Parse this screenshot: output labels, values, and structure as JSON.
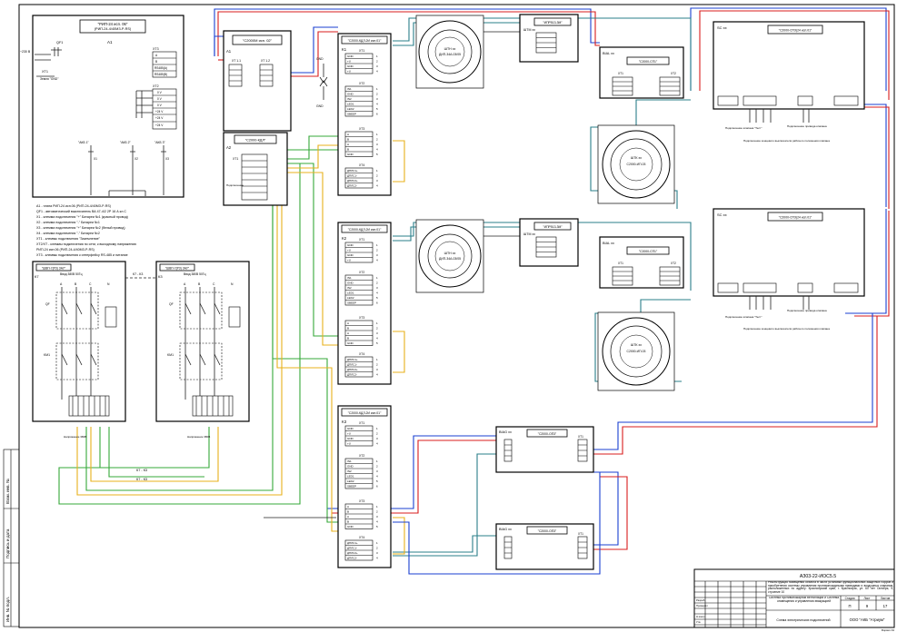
{
  "sheet": {
    "doc_code": "АЗ03-22-ИОС5.5",
    "project_title": "Реконструкция помещения объекта в части установки функциональных защитных гофров и приобретения системы управления противопожарными приводами и воздушных клапанов, расположенных по адресу: Красноярский край, г. Красноярск, ул. 60 лет Октября, 9, строение 10",
    "sheet_title": "Система противопожарной вентиляции и Система оповещения и управления эвакуацией",
    "scheme_title": "Схема электрических подключений",
    "company": "ООО \"АКБ \"Атриум\"",
    "stage_label": "Стадия",
    "stage": "П",
    "sheet_label": "Лист",
    "sheet_no": "9",
    "sheets_label": "Листов",
    "sheets_total": "17",
    "format": "Формат А3",
    "signature_rows": [
      "Разраб.",
      "Проверил",
      "Н.контр.",
      "Утв."
    ],
    "side_labels": [
      "Взам. инв. №",
      "Подпись и дата",
      "Инв. № подл."
    ]
  },
  "power_unit": {
    "id": "A1",
    "title_line1": "\"РИП-24 исп. 06\"",
    "title_line2": "(РИП-24-4/40МЗ-Р-RS)",
    "qf_label": "QF1",
    "mains_label": "~230 В",
    "ground_label": "Земля \"GND\"",
    "xt1_label": "ХТ1",
    "xt2_label": "ХТ2",
    "xt3_label": "ХТ3",
    "terminals_xt1": [
      "А",
      "В",
      "RS485(А)",
      "RS485(В)"
    ],
    "terminals_xt2": [
      "0 V",
      "0 V",
      "0 V",
      "+24 V",
      "+24 V",
      "+24 V"
    ],
    "batt_labels": [
      "\"АКБ 1\"",
      "\"АКБ 2\"",
      "\"АКБ 3\""
    ],
    "batt_ids": [
      "X1",
      "X2",
      "X3"
    ]
  },
  "legend": [
    "А1 - плата РИП-24 исп.06 (РИП-24-4/40МЗ-Р-RS)",
    "QF1 - автоматический выключатель ВА 47-4/2 2Р 16 А кл.С",
    "Х1 - клемма подключения \"+\" Батареи №1 (красный провод)",
    "Х2 - клемма подключения \"-\" Батареи №1",
    "Х3 - клемма подключения \"+\" Батареи №2 (белый провод)",
    "Х4 - клемма подключения \"-\" Батареи №2",
    "ХТ1 - клеммы подключения \"Заземление\"",
    "ХТ2/ХТ - клеммы подключения по сети, к выходному напряжению",
    "РИП-24 исп.06 (РИП-24-4/40МЗ-Р-RS)",
    "ХТ3 - клеммы подключения к интерфейсу RS-485 и питание"
  ],
  "s2000m": {
    "id": "A1",
    "title": "\"С2000М исп. 02\"",
    "xt_left": "ХТ 1.1",
    "xt_right": "ХТ 1.2"
  },
  "kdl": {
    "id": "A2",
    "title": "\"С2000-КДЛ\"",
    "xt": "ХТ1",
    "note": "Подключение"
  },
  "modules": [
    {
      "id": "K1",
      "title": "\"С2000-КДЛ-2И исп.01\""
    },
    {
      "id": "K2",
      "title": "\"С2000-КДЛ-2И исп.01\""
    },
    {
      "id": "K3",
      "title": "\"С2000-КДЛ-2И исп.01\""
    }
  ],
  "module_rows": {
    "xt1": "ХТ1",
    "xt2": "ХТ2",
    "xt3": "ХТ3",
    "xt4": "ХТ4",
    "xt1_pins": [
      "GND",
      "+U",
      "GND",
      "+U"
    ],
    "xt2_pins": [
      "IN1",
      "GND",
      "IN2",
      "LED1",
      "LED2",
      "SBEEP"
    ],
    "xt3_pins": [
      "А",
      "В",
      "А",
      "В",
      "GND"
    ],
    "xt4_pins": [
      "ДПЛС1+",
      "ДПЛС1-",
      "ДПЛС2+",
      "ДПЛС2-"
    ],
    "xt1_nums": [
      "1",
      "2",
      "3",
      "4"
    ],
    "xt2_nums": [
      "1",
      "2",
      "3",
      "4",
      "5",
      "6"
    ]
  },
  "gnd_labels": [
    "GND",
    "GND"
  ],
  "detectors_smoke": [
    {
      "tag": "ШТН хх",
      "model": "ДИП-34А-03/05"
    },
    {
      "tag": "ШТН хх",
      "model": "ДИП-34А-03/05"
    }
  ],
  "detectors_heat": [
    {
      "tag": "ШТК хх",
      "model": "С2000-ИП-03"
    },
    {
      "tag": "ШТК хх",
      "model": "С2000-ИП-03"
    }
  ],
  "small_blocks": [
    {
      "tag": "ШТМ хх",
      "title": "\"ИПР513-3М\""
    },
    {
      "tag": "ШТМ хх",
      "title": "\"ИПР513-3М\""
    }
  ],
  "bial": [
    {
      "tag": "BIAL хх",
      "title": "\"С2000-СП1\"",
      "xt1": "ХТ1",
      "xt2": "ХТ2"
    },
    {
      "tag": "BIAL хх",
      "title": "\"С2000-СП1\"",
      "xt1": "ХТ1",
      "xt2": "ХТ2"
    }
  ],
  "sc": [
    {
      "tag": "SC хх",
      "title": "\"С2000-СПЗ(24 исп.01\"",
      "notes": [
        "Подключение клапана \"Тест\"",
        "Подключение концевого выключателя рабочего положения клапана",
        "Подключение привода клапана"
      ]
    },
    {
      "tag": "SC хх",
      "title": "\"С2000-СПЗ(24 исп.01\"",
      "notes": [
        "Подключение клапана \"Тест\"",
        "Подключение концевого выключателя рабочего положения клапана",
        "Подключение привода клапана"
      ]
    }
  ],
  "biag": [
    {
      "tag": "BIAG хх",
      "title": "\"С2000-ОП3\"",
      "xt": "ХТ1"
    },
    {
      "tag": "BIAG хх",
      "title": "\"С2000-ОП3\"",
      "xt": "ХТ1"
    }
  ],
  "cabinets": [
    {
      "id": "К7",
      "title": "\"ШВП-7(РЗ) ЗАУ\"",
      "input": "Ввод 380В 50Гц",
      "qf": "QF",
      "km": "KM1",
      "bottom": "Напряжение 380В"
    },
    {
      "id": "К3",
      "title": "\"ШВП-7(РЗ) ЗАУ\"",
      "input": "Ввод 380В 50Гц",
      "qf": "QF",
      "km": "KM1",
      "bottom": "Напряжение 380В"
    }
  ],
  "link_labels": [
    "К7 - К3",
    "К7 - К3",
    "К7 - К3"
  ],
  "phases": [
    "А",
    "В",
    "С",
    "N"
  ],
  "colors": {
    "blue": "#1a3fd0",
    "red": "#d81c1c",
    "green": "#35a83a",
    "yellow": "#e8b11b",
    "teal": "#2a7f8a"
  }
}
